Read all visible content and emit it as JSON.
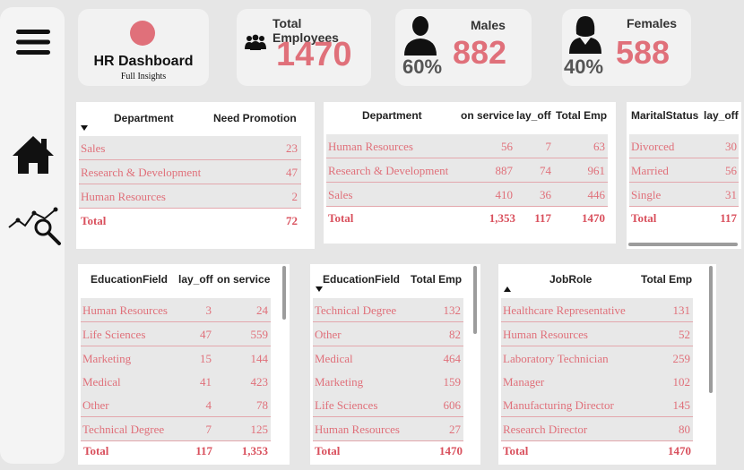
{
  "header": {
    "title": "HR Dashboard",
    "subtitle": "Full Insights",
    "accent_color": "#e0707a"
  },
  "kpis": {
    "total_label": "Total Employees",
    "total_value": "1470",
    "males_label": "Males",
    "males_value": "882",
    "males_pct": "60%",
    "females_label": "Females",
    "females_value": "588",
    "females_pct": "40%"
  },
  "tables": {
    "promotion": {
      "headers": [
        "Department",
        "Need Promotion"
      ],
      "rows": [
        [
          "Sales",
          "23"
        ],
        [
          "Research & Development",
          "47"
        ],
        [
          "Human Resources",
          "2"
        ]
      ],
      "total": [
        "Total",
        "72"
      ]
    },
    "dept_service": {
      "headers": [
        "Department",
        "on service",
        "lay_off",
        "Total Emp"
      ],
      "rows": [
        [
          "Human Resources",
          "56",
          "7",
          "63"
        ],
        [
          "Research & Development",
          "887",
          "74",
          "961"
        ],
        [
          "Sales",
          "410",
          "36",
          "446"
        ]
      ],
      "total": [
        "Total",
        "1,353",
        "117",
        "1470"
      ]
    },
    "marital": {
      "headers": [
        "MaritalStatus",
        "lay_off"
      ],
      "rows": [
        [
          "Divorced",
          "30"
        ],
        [
          "Married",
          "56"
        ],
        [
          "Single",
          "31"
        ]
      ],
      "total": [
        "Total",
        "117"
      ]
    },
    "edu_layoff": {
      "headers": [
        "EducationField",
        "lay_off",
        "on service"
      ],
      "rows": [
        [
          "Human Resources",
          "3",
          "24"
        ],
        [
          "Life Sciences",
          "47",
          "559"
        ],
        [
          "Marketing",
          "15",
          "144"
        ],
        [
          "Medical",
          "41",
          "423"
        ],
        [
          "Other",
          "4",
          "78"
        ],
        [
          "Technical Degree",
          "7",
          "125"
        ]
      ],
      "total": [
        "Total",
        "117",
        "1,353"
      ]
    },
    "edu_total": {
      "headers": [
        "EducationField",
        "Total Emp"
      ],
      "rows": [
        [
          "Technical Degree",
          "132"
        ],
        [
          "Other",
          "82"
        ],
        [
          "Medical",
          "464"
        ],
        [
          "Marketing",
          "159"
        ],
        [
          "Life Sciences",
          "606"
        ],
        [
          "Human Resources",
          "27"
        ]
      ],
      "total": [
        "Total",
        "1470"
      ]
    },
    "jobrole": {
      "headers": [
        "JobRole",
        "Total Emp"
      ],
      "rows": [
        [
          "Healthcare Representative",
          "131"
        ],
        [
          "Human Resources",
          "52"
        ],
        [
          "Laboratory Technician",
          "259"
        ],
        [
          "Manager",
          "102"
        ],
        [
          "Manufacturing Director",
          "145"
        ],
        [
          "Research Director",
          "80"
        ]
      ],
      "total": [
        "Total",
        "1470"
      ]
    }
  },
  "icons": [
    "menu-icon",
    "home-icon",
    "analytics-icon",
    "people-icon",
    "male-icon",
    "female-icon"
  ]
}
